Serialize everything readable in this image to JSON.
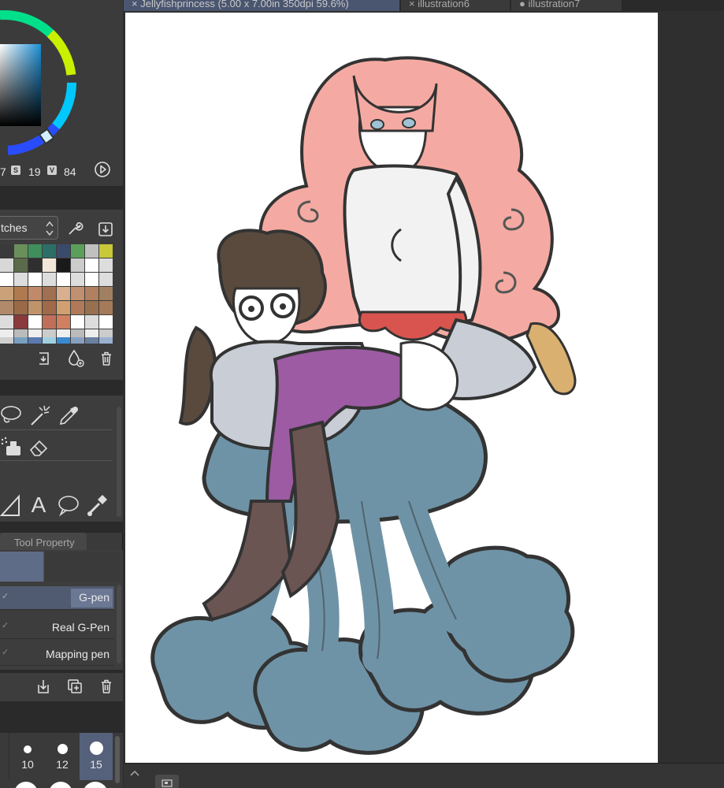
{
  "color": {
    "h_partial": "7",
    "s_label": "S",
    "s_value": "19",
    "v_label": "V",
    "v_value": "84"
  },
  "palette": {
    "select_label": "tches"
  },
  "tool_property": {
    "tab_label": "Tool Property",
    "brushes": [
      {
        "label": "G-pen",
        "selected": true
      },
      {
        "label": "Real G-Pen",
        "selected": false
      },
      {
        "label": "Mapping pen",
        "selected": false
      }
    ]
  },
  "brush_size": {
    "sizes": [
      {
        "label": "10"
      },
      {
        "label": "12"
      },
      {
        "label": "15"
      }
    ]
  },
  "document_tabs": [
    {
      "label": "Jellyfishprincess (5.00 x 7.00in 350dpi 59.6%)",
      "active": true,
      "close_glyph": "×"
    },
    {
      "label": "illustration6",
      "active": false,
      "close_glyph": "×"
    },
    {
      "label": "illustration7",
      "active": false,
      "close_glyph": "●"
    }
  ],
  "tools": {
    "text_tool_glyph": "A"
  },
  "colors": {
    "accent": "#5f6c87",
    "panel_bg": "#3a3a3a",
    "canvas_bg": "#2f2f2f"
  }
}
